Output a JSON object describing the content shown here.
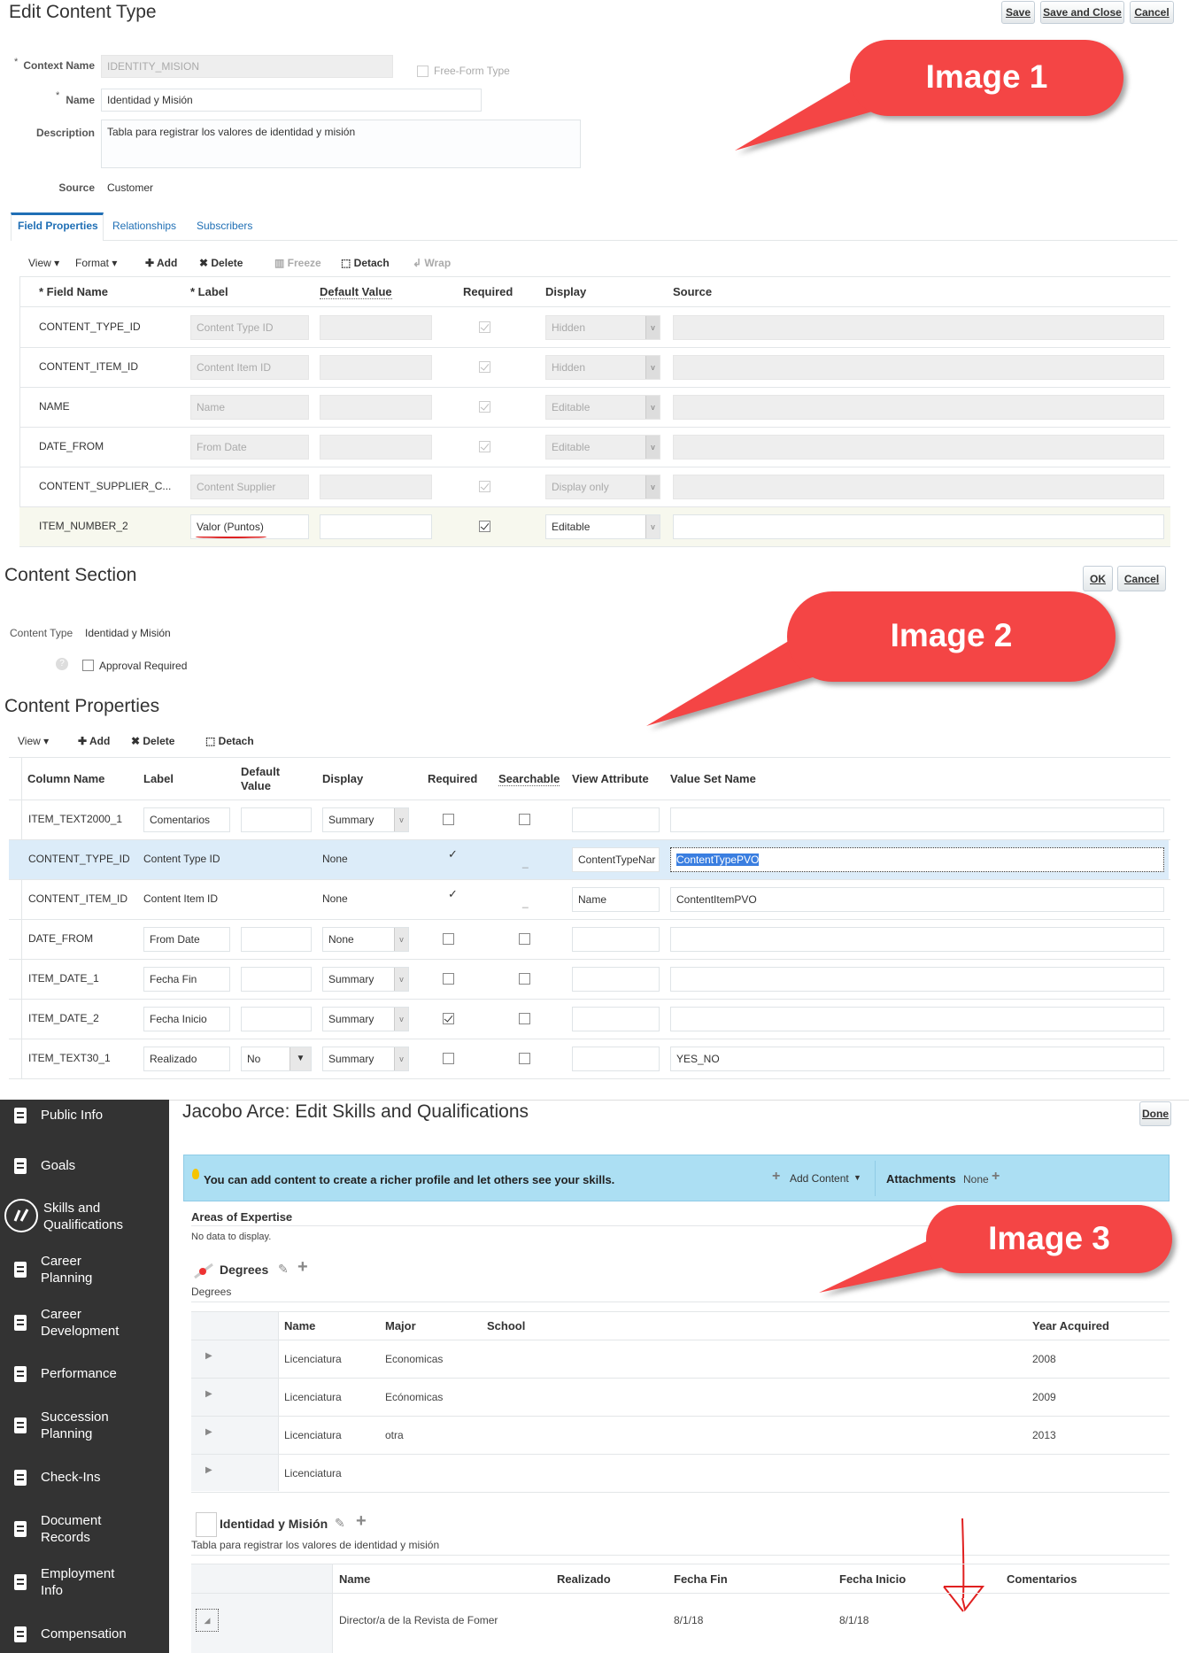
{
  "image1": {
    "title": "Edit Content Type",
    "buttons": {
      "save": "Save",
      "save_close": "Save and Close",
      "cancel": "Cancel"
    },
    "form": {
      "context_name_label": "Context Name",
      "context_name_value": "IDENTITY_MISION",
      "free_form_label": "Free-Form Type",
      "name_label": "Name",
      "name_value": "Identidad y Misión",
      "description_label": "Description",
      "description_value": "Tabla para registrar los valores de identidad y misión",
      "source_label": "Source",
      "source_value": "Customer",
      "required_mark": "*"
    },
    "tabs": [
      "Field Properties",
      "Relationships",
      "Subscribers"
    ],
    "toolbar": {
      "view": "View",
      "format": "Format",
      "add": "Add",
      "delete": "Delete",
      "freeze": "Freeze",
      "detach": "Detach",
      "wrap": "Wrap"
    },
    "columns": [
      "Field Name",
      "Label",
      "Default Value",
      "Required",
      "Display",
      "Source"
    ],
    "rows": [
      {
        "field": "CONTENT_TYPE_ID",
        "label": "Content Type ID",
        "default": "",
        "required": true,
        "display": "Hidden",
        "editable": false
      },
      {
        "field": "CONTENT_ITEM_ID",
        "label": "Content Item ID",
        "default": "",
        "required": true,
        "display": "Hidden",
        "editable": false
      },
      {
        "field": "NAME",
        "label": "Name",
        "default": "",
        "required": true,
        "display": "Editable",
        "editable": false
      },
      {
        "field": "DATE_FROM",
        "label": "From Date",
        "default": "",
        "required": true,
        "display": "Editable",
        "editable": false
      },
      {
        "field": "CONTENT_SUPPLIER_C...",
        "label": "Content Supplier",
        "default": "",
        "required": true,
        "display": "Display only",
        "editable": false
      },
      {
        "field": "ITEM_NUMBER_2",
        "label": "Valor (Puntos)",
        "default": "",
        "required": true,
        "display": "Editable",
        "editable": true
      }
    ],
    "callout": "Image 1"
  },
  "image2": {
    "title": "Content Section",
    "buttons": {
      "ok": "OK",
      "cancel": "Cancel"
    },
    "content_type_label": "Content Type",
    "content_type_value": "Identidad y Misión",
    "approval_label": "Approval Required",
    "properties_title": "Content Properties",
    "toolbar": {
      "view": "View",
      "add": "Add",
      "delete": "Delete",
      "detach": "Detach"
    },
    "columns": [
      "Column Name",
      "Label",
      "Default Value",
      "Display",
      "Required",
      "Searchable",
      "View Attribute",
      "Value Set Name"
    ],
    "rows": [
      {
        "col": "ITEM_TEXT2000_1",
        "label": "Comentarios",
        "default": "",
        "display": "Summary",
        "required": false,
        "searchable": false,
        "view_attr": "",
        "value_set": "",
        "readonly": false
      },
      {
        "col": "CONTENT_TYPE_ID",
        "label": "Content Type ID",
        "default": "",
        "display": "None",
        "required": true,
        "searchable": false,
        "view_attr": "ContentTypeNar",
        "value_set": "ContentTypePVO",
        "readonly": true,
        "selected": true
      },
      {
        "col": "CONTENT_ITEM_ID",
        "label": "Content Item ID",
        "default": "",
        "display": "None",
        "required": true,
        "searchable": false,
        "view_attr": "Name",
        "value_set": "ContentItemPVO",
        "readonly": true
      },
      {
        "col": "DATE_FROM",
        "label": "From Date",
        "default": "",
        "display": "None",
        "required": false,
        "searchable": false,
        "view_attr": "",
        "value_set": "",
        "readonly": false
      },
      {
        "col": "ITEM_DATE_1",
        "label": "Fecha Fin",
        "default": "",
        "display": "Summary",
        "required": false,
        "searchable": false,
        "view_attr": "",
        "value_set": "",
        "readonly": false
      },
      {
        "col": "ITEM_DATE_2",
        "label": "Fecha Inicio",
        "default": "",
        "display": "Summary",
        "required": true,
        "searchable": false,
        "view_attr": "",
        "value_set": "",
        "readonly": false
      },
      {
        "col": "ITEM_TEXT30_1",
        "label": "Realizado",
        "default": "No",
        "display": "Summary",
        "required": false,
        "searchable": false,
        "view_attr": "",
        "value_set": "YES_NO",
        "readonly": false,
        "default_select": true
      }
    ],
    "callout": "Image 2"
  },
  "image3": {
    "sidebar": [
      {
        "label": "Public Info",
        "icon": "id-badge-icon"
      },
      {
        "label": "Goals",
        "icon": "target-icon"
      },
      {
        "label": "Skills and Qualifications",
        "icon": "skills-icon"
      },
      {
        "label": "Career Planning",
        "icon": "signpost-icon"
      },
      {
        "label": "Career Development",
        "icon": "signpost-icon"
      },
      {
        "label": "Performance",
        "icon": "bar-chart-icon"
      },
      {
        "label": "Succession Planning",
        "icon": "people-icon"
      },
      {
        "label": "Check-Ins",
        "icon": "checklist-icon"
      },
      {
        "label": "Document Records",
        "icon": "document-icon"
      },
      {
        "label": "Employment Info",
        "icon": "employment-icon"
      },
      {
        "label": "Compensation",
        "icon": "compensation-icon"
      }
    ],
    "title": "Jacobo Arce: Edit Skills and Qualifications",
    "done": "Done",
    "banner": {
      "text": "You can add content to create a richer profile and let others see your skills.",
      "add_content": "Add Content",
      "attachments_label": "Attachments",
      "attachments_value": "None"
    },
    "areas_title": "Areas of Expertise",
    "no_data": "No data to display.",
    "degrees_title": "Degrees",
    "degrees_desc": "Degrees",
    "degrees_columns": [
      "Name",
      "Major",
      "School",
      "Year Acquired"
    ],
    "degrees_rows": [
      {
        "name": "Licenciatura",
        "major": "Economicas",
        "school": "",
        "year": "2008"
      },
      {
        "name": "Licenciatura",
        "major": "Ecónomicas",
        "school": "",
        "year": "2009"
      },
      {
        "name": "Licenciatura",
        "major": "otra",
        "school": "",
        "year": "2013"
      },
      {
        "name": "Licenciatura",
        "major": "",
        "school": "",
        "year": ""
      }
    ],
    "identidad_title": "Identidad y Misión",
    "identidad_desc": "Tabla para registrar los valores de identidad y misión",
    "identidad_columns": [
      "Name",
      "Realizado",
      "Fecha Fin",
      "Fecha Inicio",
      "Comentarios"
    ],
    "identidad_rows": [
      {
        "name": "Director/a de la Revista de Fomer",
        "realizado": "",
        "fecha_fin": "8/1/18",
        "fecha_inicio": "8/1/18",
        "comentarios": ""
      }
    ],
    "callout": "Image 3"
  },
  "colors": {
    "callout": "#f44545",
    "banner": "#acdff3",
    "sidebar": "#333333",
    "link": "#1f6fb5",
    "selected_row": "#dcecf9"
  }
}
